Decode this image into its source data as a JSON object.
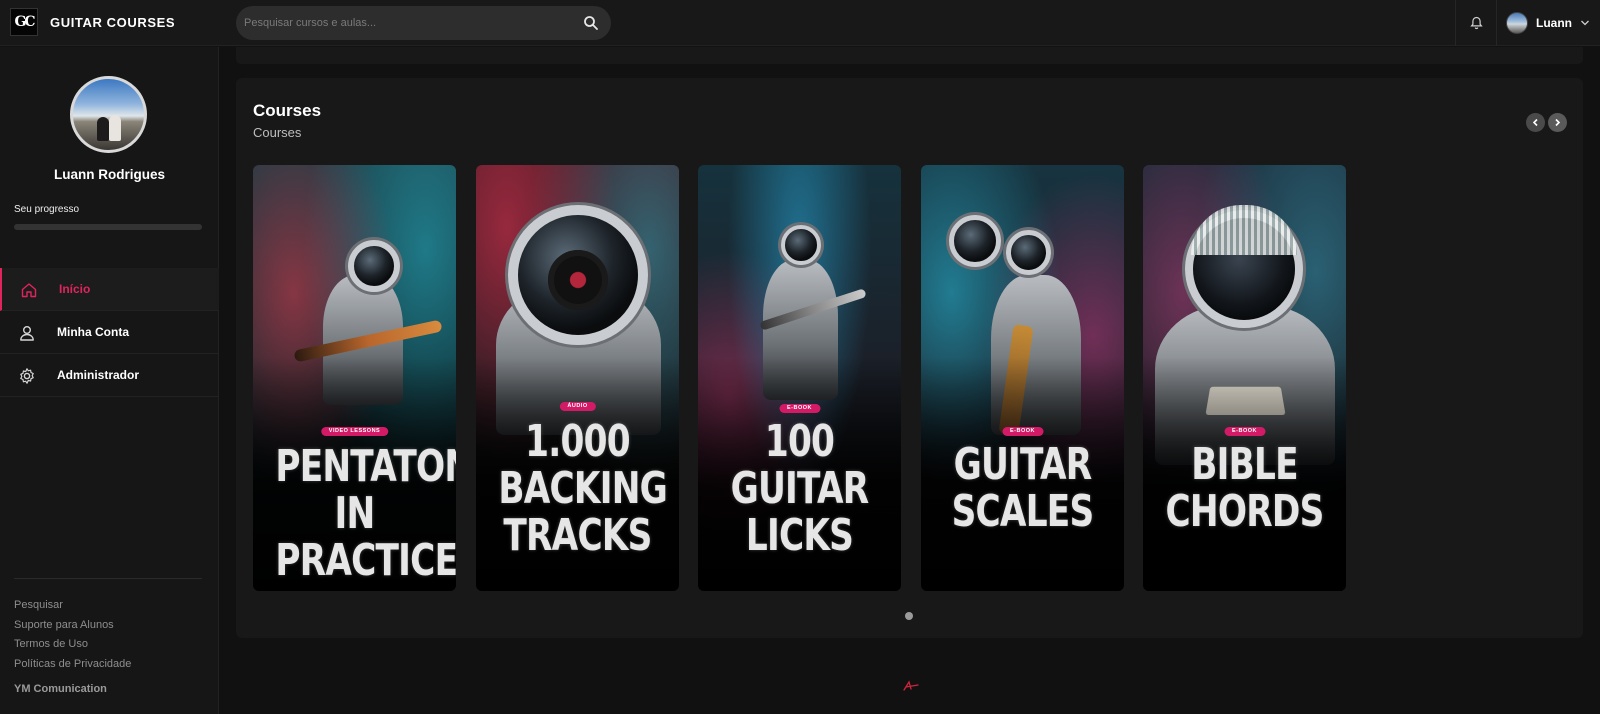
{
  "header": {
    "logo_text": "GC",
    "brand": "GUITAR COURSES",
    "search_placeholder": "Pesquisar cursos e aulas...",
    "user_name": "Luann",
    "icons": [
      "search-icon",
      "bell-icon",
      "chevron-down-icon"
    ]
  },
  "sidebar": {
    "profile_name": "Luann Rodrigues",
    "progress_label": "Seu progresso",
    "progress_value": 0,
    "nav": [
      {
        "label": "Início",
        "icon": "home-icon",
        "active": true
      },
      {
        "label": "Minha Conta",
        "icon": "user-icon",
        "active": false
      },
      {
        "label": "Administrador",
        "icon": "gear-icon",
        "active": false
      }
    ],
    "footer_links": [
      "Pesquisar",
      "Suporte para Alunos",
      "Termos de Uso",
      "Políticas de Privacidade"
    ],
    "company": "YM Comunication"
  },
  "main": {
    "section_title": "Courses",
    "section_subtitle": "Courses",
    "courses": [
      {
        "tag": "VIDEO LESSONS",
        "title": "PENTATONIC\nIN PRACTICE"
      },
      {
        "tag": "ÁUDIO",
        "title": "1.000\nBACKING\nTRACKS"
      },
      {
        "tag": "E-BOOK",
        "title": "100\nGUITAR\nLICKS"
      },
      {
        "tag": "E-BOOK",
        "title": "GUITAR\nSCALES"
      },
      {
        "tag": "E-BOOK",
        "title": "BIBLE\nCHORDS"
      }
    ],
    "pagination_pages": 1,
    "pagination_current": 1
  },
  "colors": {
    "accent": "#e0245e",
    "tag": "#d31a67",
    "background": "#111111",
    "panel": "#181818"
  }
}
